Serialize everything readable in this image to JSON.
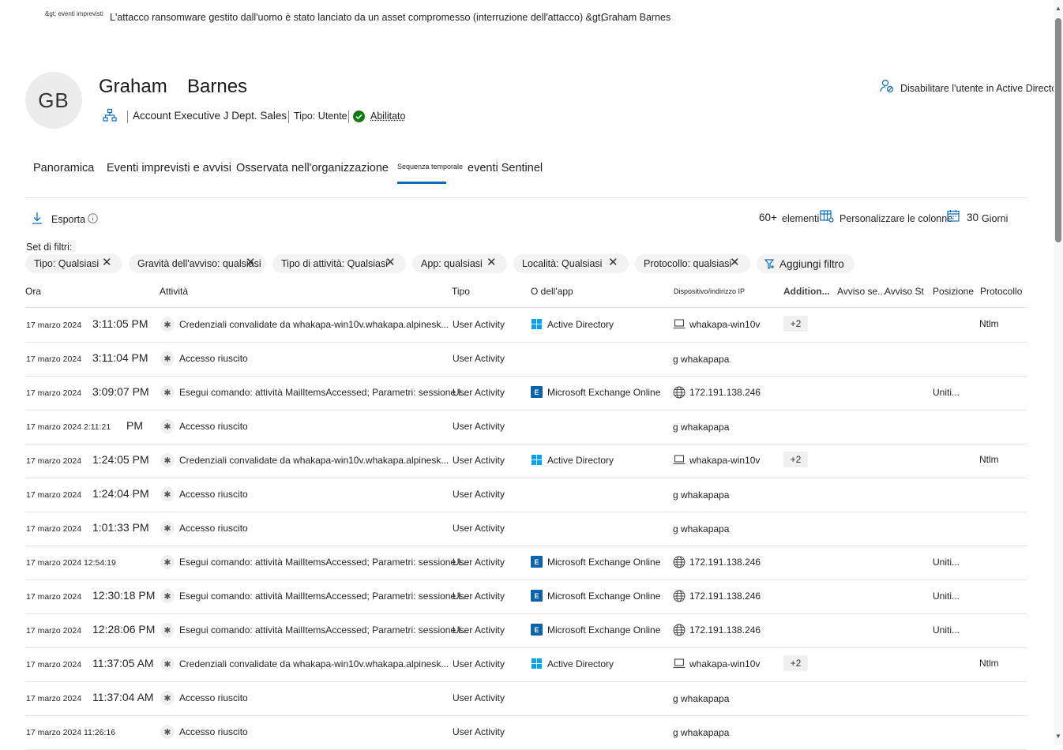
{
  "breadcrumb": {
    "root": "&gt; eventi imprevisti",
    "incident": "L'attacco ransomware gestito dall'uomo è stato lanciato da un asset compromesso (interruzione dell'attacco) &gt;",
    "current": "Graham Barnes"
  },
  "user": {
    "initials": "GB",
    "first_name": "Graham",
    "last_name": "Barnes",
    "title_dept": "Account Executive J Dept. Sales",
    "type": "Tipo: Utente",
    "status": "Abilitato",
    "disable_action": "Disabilitare l'utente in Active Directory"
  },
  "tabs": [
    {
      "label": "Panoramica",
      "active": false
    },
    {
      "label": "Eventi imprevisti e avvisi",
      "active": false
    },
    {
      "label": "Osservata nell'organizzazione",
      "active": false
    },
    {
      "label": "Sequenza temporale",
      "active": true
    },
    {
      "label": "eventi Sentinel",
      "active": false
    }
  ],
  "toolbar": {
    "export": "Esporta",
    "items_count": "60+",
    "items_label": "elementi",
    "customize_columns": "Personalizzare le colonne",
    "days_value": "30",
    "days_label": "Giorni"
  },
  "filters": {
    "label": "Set di filtri:",
    "pills": [
      "Tipo: Qualsiasi",
      "Gravità dell'avviso: qualsiasi",
      "Tipo di attività: Qualsiasi",
      "App: qualsiasi",
      "Località: Qualsiasi",
      "Protocollo: qualsiasi"
    ],
    "add_filter": "Aggiungi filtro"
  },
  "columns": {
    "ora": "Ora",
    "attivita": "Attività",
    "tipo": "Tipo",
    "app": "O dell'app",
    "device": "Dispositivo/indirizzo IP",
    "additional": "Addition...",
    "alert_sev": "Avviso se...",
    "alert_st": "Avviso St",
    "location": "Posizione",
    "protocol": "Protocollo"
  },
  "rows": [
    {
      "date": "17 marzo 2024",
      "time": "3:11:05 PM",
      "activity": "Credenziali convalidate da whakapa-win10v.whakapa.alpinesk...",
      "type": "User Activity",
      "app": "Active Directory",
      "app_icon": "windows",
      "device": "whakapa-win10v",
      "device_kind": "device",
      "additional": "+2",
      "location": "",
      "protocol": "Ntlm"
    },
    {
      "date": "17 marzo 2024",
      "time": "3:11:04 PM",
      "activity": "Accesso riuscito",
      "type": "User Activity",
      "app": "",
      "app_icon": "",
      "device": "g whakapapa",
      "device_kind": "text",
      "additional": "",
      "location": "",
      "protocol": ""
    },
    {
      "date": "17 marzo 2024",
      "time": "3:09:07 PM",
      "activity": "Esegui comando: attività MailItemsAccessed; Parametri: sessione l...",
      "type": "User Activity",
      "app": "Microsoft Exchange Online",
      "app_icon": "exchange",
      "device": "172.191.138.246",
      "device_kind": "ip",
      "additional": "",
      "location": "Uniti...",
      "protocol": ""
    },
    {
      "date": "17 marzo 2024 2:11:21",
      "time": "PM",
      "activity": "Accesso riuscito",
      "type": "User Activity",
      "app": "",
      "app_icon": "",
      "device": "g whakapapa",
      "device_kind": "text",
      "additional": "",
      "location": "",
      "protocol": ""
    },
    {
      "date": "17 marzo 2024",
      "time": "1:24:05 PM",
      "activity": "Credenziali convalidate da whakapa-win10v.whakapa.alpinesk...",
      "type": "User Activity",
      "app": "Active Directory",
      "app_icon": "windows",
      "device": "whakapa-win10v",
      "device_kind": "device",
      "additional": "+2",
      "location": "",
      "protocol": "Ntlm"
    },
    {
      "date": "17 marzo 2024",
      "time": "1:24:04 PM",
      "activity": "Accesso riuscito",
      "type": "User Activity",
      "app": "",
      "app_icon": "",
      "device": "g whakapapa",
      "device_kind": "text",
      "additional": "",
      "location": "",
      "protocol": ""
    },
    {
      "date": "17 marzo 2024",
      "time": "1:01:33 PM",
      "activity": "Accesso riuscito",
      "type": "User Activity",
      "app": "",
      "app_icon": "",
      "device": "g whakapapa",
      "device_kind": "text",
      "additional": "",
      "location": "",
      "protocol": ""
    },
    {
      "date": "17 marzo 2024 12:54:19",
      "time": "",
      "activity": "Esegui comando: attività MailItemsAccessed; Parametri: sessione l...",
      "type": "User Activity",
      "app": "Microsoft Exchange Online",
      "app_icon": "exchange",
      "device": "172.191.138.246",
      "device_kind": "ip",
      "additional": "",
      "location": "Uniti...",
      "protocol": ""
    },
    {
      "date": "17 marzo 2024",
      "time": "12:30:18 PM",
      "activity": "Esegui comando: attività MailItemsAccessed; Parametri: sessione l...",
      "type": "User Activity",
      "app": "Microsoft Exchange Online",
      "app_icon": "exchange",
      "device": "172.191.138.246",
      "device_kind": "ip",
      "additional": "",
      "location": "Uniti...",
      "protocol": ""
    },
    {
      "date": "17 marzo 2024",
      "time": "12:28:06 PM",
      "activity": "Esegui comando: attività MailItemsAccessed; Parametri: sessione l...",
      "type": "User Activity",
      "app": "Microsoft Exchange Online",
      "app_icon": "exchange",
      "device": "172.191.138.246",
      "device_kind": "ip",
      "additional": "",
      "location": "Uniti...",
      "protocol": ""
    },
    {
      "date": "17 marzo 2024",
      "time": "11:37:05 AM",
      "activity": "Credenziali convalidate da whakapa-win10v.whakapa.alpinesk...",
      "type": "User Activity",
      "app": "Active Directory",
      "app_icon": "windows",
      "device": "whakapa-win10v",
      "device_kind": "device",
      "additional": "+2",
      "location": "",
      "protocol": "Ntlm"
    },
    {
      "date": "17 marzo 2024",
      "time": "11:37:04 AM",
      "activity": "Accesso riuscito",
      "type": "User Activity",
      "app": "",
      "app_icon": "",
      "device": "g whakapapa",
      "device_kind": "text",
      "additional": "",
      "location": "",
      "protocol": ""
    },
    {
      "date": "17 marzo 2024 11:26:16",
      "time": "",
      "activity": "Accesso riuscito",
      "type": "User Activity",
      "app": "",
      "app_icon": "",
      "device": "g whakapapa",
      "device_kind": "text",
      "additional": "",
      "location": "",
      "protocol": ""
    }
  ]
}
